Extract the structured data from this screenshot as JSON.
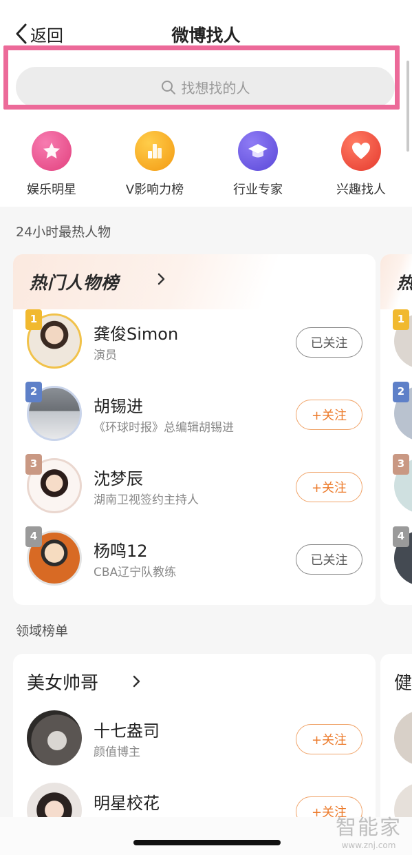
{
  "header": {
    "back_label": "返回",
    "title": "微博找人"
  },
  "search": {
    "placeholder": "找想找的人"
  },
  "categories": [
    {
      "label": "娱乐明星",
      "icon": "star-icon",
      "color": "#e94f8a"
    },
    {
      "label": "V影响力榜",
      "icon": "chart-bars-icon",
      "color": "#f4a81e"
    },
    {
      "label": "行业专家",
      "icon": "graduation-cap-icon",
      "color": "#6a58e0"
    },
    {
      "label": "兴趣找人",
      "icon": "heart-icon",
      "color": "#ee4b3b"
    }
  ],
  "hot": {
    "section_title": "24小时最热人物",
    "card_title": "热门人物榜",
    "peek_title": "热",
    "people": [
      {
        "rank": "1",
        "name": "龚俊Simon",
        "desc": "演员",
        "button": "已关注",
        "followed": true
      },
      {
        "rank": "2",
        "name": "胡锡进",
        "desc": "《环球时报》总编辑胡锡进",
        "button": "+关注",
        "followed": false
      },
      {
        "rank": "3",
        "name": "沈梦辰",
        "desc": "湖南卫视签约主持人",
        "button": "+关注",
        "followed": false
      },
      {
        "rank": "4",
        "name": "杨鸣12",
        "desc": "CBA辽宁队教练",
        "button": "已关注",
        "followed": true
      }
    ]
  },
  "domain": {
    "section_title": "领域榜单",
    "card_title": "美女帅哥",
    "peek_title": "健",
    "people": [
      {
        "name": "十七盎司",
        "desc": "颜值博主",
        "button": "+关注"
      },
      {
        "name": "明星校花",
        "desc": "",
        "button": "+关注"
      }
    ]
  },
  "watermark": {
    "line1": "智能家",
    "line2": "www.znj.com"
  },
  "colors": {
    "accent_orange": "#ec7a2a",
    "highlight_pink": "#ec6a99",
    "rank_gold": "#f1b92f",
    "rank_blue": "#5e80c8",
    "rank_bronze": "#c99883",
    "rank_gray": "#9a9a9a"
  }
}
